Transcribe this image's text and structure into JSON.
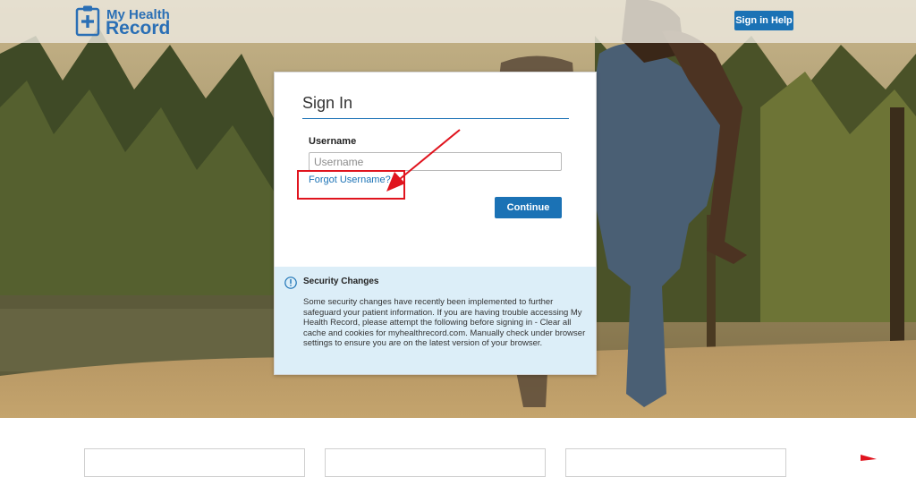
{
  "header": {
    "logo_line1": "My Health",
    "logo_line2": "Record",
    "help_button": "Sign in Help"
  },
  "signin": {
    "title": "Sign In",
    "username_label": "Username",
    "username_placeholder": "Username",
    "username_value": "",
    "forgot_link": "Forgot Username?",
    "continue_button": "Continue"
  },
  "notice": {
    "icon": "info-circle-icon",
    "title": "Security Changes",
    "body": "Some security changes have recently been implemented to further safeguard your patient information. If you are having trouble accessing My Health Record, please attempt the following before signing in - Clear all cache and cookies for myhealthrecord.com. Manually check under browser settings to ensure you are on the latest version of your browser."
  },
  "colors": {
    "brand_blue": "#1b72b5",
    "annotation_red": "#e0141e",
    "notice_bg": "#dceef8"
  }
}
